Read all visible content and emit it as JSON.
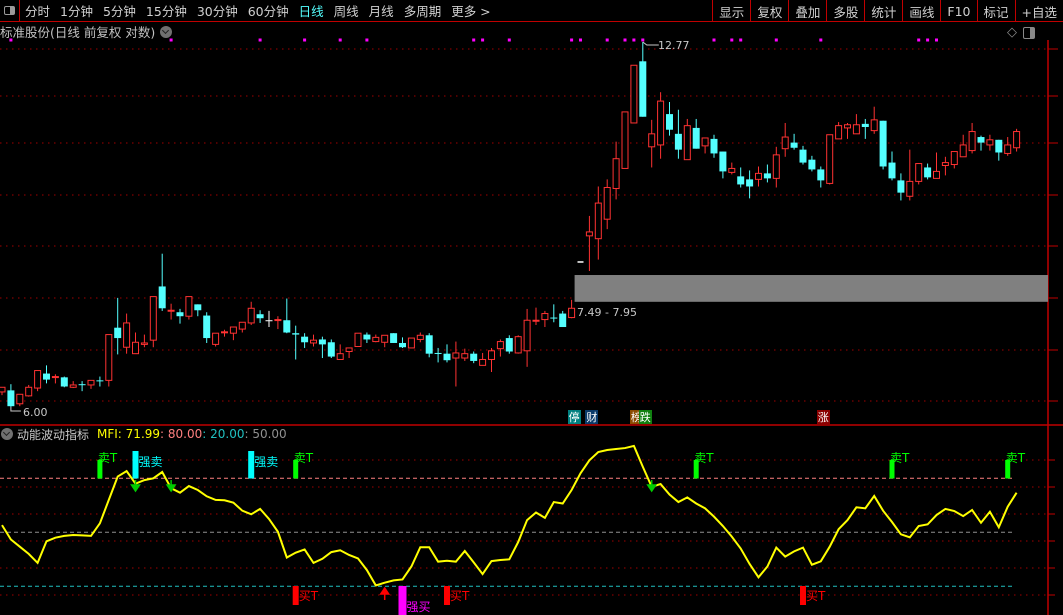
{
  "menubar": {
    "periods": [
      "分时",
      "1分钟",
      "5分钟",
      "15分钟",
      "30分钟",
      "60分钟",
      "日线",
      "周线",
      "月线",
      "多周期",
      "更多 >"
    ],
    "active_period": "日线",
    "buttons": [
      "显示",
      "复权",
      "叠加",
      "多股",
      "统计",
      "画线",
      "F10",
      "标记",
      "+自选"
    ]
  },
  "status": {
    "title": "标准股份(日线 前复权 对数)"
  },
  "annotations": {
    "high": "12.77",
    "low": "6.00",
    "gap": "7.49 - 7.95"
  },
  "badges": [
    {
      "label": "停",
      "index": 64,
      "color": "#008080"
    },
    {
      "label": "财",
      "index": 66,
      "color": "#0a3a6a"
    },
    {
      "label": "榜",
      "index": 71,
      "color": "#8a4a00"
    },
    {
      "label": "跌",
      "index": 72,
      "color": "#108010"
    },
    {
      "label": "涨",
      "index": 92,
      "color": "#8a0000"
    }
  ],
  "indicator": {
    "name": "动能波动指标",
    "mfi_label": "MFI: 71.99",
    "l80_label": ": 80.00",
    "l20_label": ": 20.00",
    "l50_label": ": 50.00",
    "sell_t": "卖T",
    "strong_sell": "强卖",
    "buy_t": "买T",
    "strong_buy": "强买"
  },
  "colors": {
    "up": "#ff3232",
    "down": "#54ffff",
    "doji": "#ffffff",
    "mfi": "#ffff00",
    "grid": "#a00000"
  },
  "chart_data": {
    "type": "candlestick",
    "scale": "log",
    "price_range": [
      6.0,
      12.77
    ],
    "gap": [
      7.49,
      7.95
    ],
    "ohlc_format": [
      "open",
      "high",
      "low",
      "close"
    ],
    "candles": [
      [
        6.19,
        6.25,
        6.15,
        6.25
      ],
      [
        6.21,
        6.29,
        6.0,
        6.01
      ],
      [
        6.04,
        6.16,
        6.01,
        6.16
      ],
      [
        6.14,
        6.28,
        6.13,
        6.25
      ],
      [
        6.24,
        6.47,
        6.2,
        6.47
      ],
      [
        6.43,
        6.54,
        6.3,
        6.35
      ],
      [
        6.38,
        6.42,
        6.3,
        6.39
      ],
      [
        6.38,
        6.39,
        6.25,
        6.26
      ],
      [
        6.25,
        6.33,
        6.24,
        6.28
      ],
      [
        6.29,
        6.33,
        6.2,
        6.28
      ],
      [
        6.28,
        6.34,
        6.23,
        6.34
      ],
      [
        6.34,
        6.39,
        6.26,
        6.33
      ],
      [
        6.34,
        6.97,
        6.26,
        6.97
      ],
      [
        7.07,
        7.52,
        6.69,
        6.92
      ],
      [
        6.79,
        7.28,
        6.7,
        7.14
      ],
      [
        6.7,
        7.0,
        6.7,
        6.86
      ],
      [
        6.83,
        6.97,
        6.79,
        6.85
      ],
      [
        6.89,
        7.54,
        6.79,
        7.54
      ],
      [
        7.7,
        8.24,
        7.32,
        7.36
      ],
      [
        7.32,
        7.43,
        7.19,
        7.33
      ],
      [
        7.3,
        7.35,
        7.13,
        7.24
      ],
      [
        7.24,
        7.54,
        7.19,
        7.54
      ],
      [
        7.42,
        7.42,
        7.24,
        7.33
      ],
      [
        7.25,
        7.3,
        6.85,
        6.92
      ],
      [
        6.83,
        6.99,
        6.8,
        6.99
      ],
      [
        7.0,
        7.04,
        6.94,
        7.01
      ],
      [
        6.99,
        7.08,
        6.89,
        7.08
      ],
      [
        7.05,
        7.15,
        7.0,
        7.15
      ],
      [
        7.14,
        7.46,
        7.11,
        7.36
      ],
      [
        7.27,
        7.33,
        7.14,
        7.21
      ],
      [
        7.18,
        7.32,
        7.08,
        7.18
      ],
      [
        7.18,
        7.24,
        7.05,
        7.19
      ],
      [
        7.18,
        7.51,
        6.99,
        7.0
      ],
      [
        6.99,
        7.1,
        6.62,
        6.97
      ],
      [
        6.94,
        6.99,
        6.78,
        6.86
      ],
      [
        6.85,
        6.97,
        6.8,
        6.89
      ],
      [
        6.9,
        6.94,
        6.64,
        6.83
      ],
      [
        6.86,
        6.9,
        6.64,
        6.66
      ],
      [
        6.62,
        6.83,
        6.62,
        6.7
      ],
      [
        6.73,
        6.78,
        6.64,
        6.78
      ],
      [
        6.8,
        6.99,
        6.8,
        6.99
      ],
      [
        6.97,
        7.0,
        6.85,
        6.9
      ],
      [
        6.87,
        6.97,
        6.86,
        6.93
      ],
      [
        6.86,
        6.96,
        6.79,
        6.96
      ],
      [
        6.99,
        6.99,
        6.85,
        6.85
      ],
      [
        6.85,
        6.93,
        6.78,
        6.79
      ],
      [
        6.78,
        6.92,
        6.78,
        6.92
      ],
      [
        6.9,
        7.0,
        6.86,
        6.96
      ],
      [
        6.96,
        6.99,
        6.65,
        6.7
      ],
      [
        6.71,
        6.78,
        6.58,
        6.7
      ],
      [
        6.7,
        6.83,
        6.58,
        6.61
      ],
      [
        6.64,
        6.87,
        6.26,
        6.71
      ],
      [
        6.64,
        6.77,
        6.6,
        6.7
      ],
      [
        6.7,
        6.73,
        6.57,
        6.6
      ],
      [
        6.54,
        6.71,
        6.54,
        6.62
      ],
      [
        6.62,
        6.78,
        6.45,
        6.74
      ],
      [
        6.77,
        6.9,
        6.66,
        6.87
      ],
      [
        6.92,
        6.96,
        6.7,
        6.73
      ],
      [
        6.71,
        6.96,
        6.7,
        6.94
      ],
      [
        6.74,
        7.35,
        6.52,
        7.18
      ],
      [
        7.17,
        7.37,
        7.11,
        7.18
      ],
      [
        7.19,
        7.32,
        7.08,
        7.28
      ],
      [
        7.22,
        7.42,
        7.15,
        7.21
      ],
      [
        7.28,
        7.32,
        7.08,
        7.08
      ],
      [
        7.22,
        7.49,
        7.21,
        7.36
      ],
      [
        8.1,
        8.1,
        8.1,
        8.1
      ],
      [
        8.55,
        8.91,
        7.95,
        8.62
      ],
      [
        8.5,
        9.47,
        8.14,
        9.15
      ],
      [
        8.85,
        9.61,
        8.67,
        9.45
      ],
      [
        9.43,
        10.39,
        9.22,
        10.03
      ],
      [
        9.83,
        11.05,
        9.83,
        11.05
      ],
      [
        10.8,
        12.17,
        10.8,
        12.17
      ],
      [
        12.27,
        12.77,
        10.94,
        10.94
      ],
      [
        10.28,
        10.87,
        9.85,
        10.56
      ],
      [
        10.32,
        11.51,
        10.03,
        11.3
      ],
      [
        11.0,
        11.28,
        10.52,
        10.65
      ],
      [
        10.56,
        11.1,
        10.03,
        10.22
      ],
      [
        10.01,
        10.89,
        10.01,
        10.74
      ],
      [
        10.69,
        10.89,
        10.24,
        10.24
      ],
      [
        10.3,
        10.47,
        10.14,
        10.47
      ],
      [
        10.45,
        10.54,
        10.05,
        10.14
      ],
      [
        10.18,
        10.18,
        9.63,
        9.77
      ],
      [
        9.75,
        9.95,
        9.71,
        9.83
      ],
      [
        9.67,
        9.85,
        9.45,
        9.51
      ],
      [
        9.61,
        9.79,
        9.24,
        9.47
      ],
      [
        9.61,
        9.87,
        9.47,
        9.73
      ],
      [
        9.73,
        9.91,
        9.55,
        9.63
      ],
      [
        9.63,
        10.28,
        9.45,
        10.11
      ],
      [
        10.24,
        10.8,
        10.07,
        10.49
      ],
      [
        10.37,
        10.56,
        10.22,
        10.26
      ],
      [
        10.22,
        10.3,
        9.91,
        9.95
      ],
      [
        10.01,
        10.09,
        9.77,
        9.81
      ],
      [
        9.81,
        9.87,
        9.45,
        9.59
      ],
      [
        9.53,
        10.54,
        9.51,
        10.54
      ],
      [
        10.45,
        10.82,
        10.45,
        10.74
      ],
      [
        10.69,
        10.8,
        10.45,
        10.76
      ],
      [
        10.56,
        11.0,
        10.56,
        10.76
      ],
      [
        10.78,
        10.89,
        10.45,
        10.71
      ],
      [
        10.63,
        11.17,
        10.56,
        10.87
      ],
      [
        10.85,
        10.85,
        9.81,
        9.87
      ],
      [
        9.95,
        10.18,
        9.59,
        9.63
      ],
      [
        9.59,
        9.73,
        9.2,
        9.35
      ],
      [
        9.28,
        10.22,
        9.2,
        9.57
      ],
      [
        9.57,
        9.93,
        9.51,
        9.93
      ],
      [
        9.85,
        9.93,
        9.61,
        9.65
      ],
      [
        9.63,
        10.16,
        9.63,
        9.77
      ],
      [
        9.89,
        10.07,
        9.69,
        9.95
      ],
      [
        9.91,
        10.18,
        9.83,
        10.18
      ],
      [
        10.07,
        10.54,
        10.07,
        10.32
      ],
      [
        10.2,
        10.8,
        10.14,
        10.61
      ],
      [
        10.49,
        10.52,
        10.2,
        10.37
      ],
      [
        10.32,
        10.54,
        10.2,
        10.43
      ],
      [
        10.43,
        10.43,
        9.99,
        10.16
      ],
      [
        10.14,
        10.49,
        10.09,
        10.32
      ],
      [
        10.26,
        10.67,
        10.18,
        10.61
      ]
    ],
    "top_markers": [
      1,
      19,
      29,
      34,
      38,
      41,
      53,
      54,
      57,
      64,
      65,
      68,
      70,
      71,
      72,
      80,
      82,
      83,
      87,
      92,
      103,
      104,
      105
    ],
    "mfi": {
      "levels": [
        80,
        50,
        20
      ],
      "values": [
        54,
        46,
        42,
        38,
        33,
        45,
        47,
        48,
        48.5,
        48.3,
        48,
        55,
        68,
        81,
        84,
        77,
        79,
        80,
        83.5,
        74.5,
        72,
        75.7,
        73.5,
        70,
        68,
        67.8,
        66.5,
        62,
        60,
        63,
        57.4,
        50.3,
        36,
        38.7,
        40.5,
        33,
        35.3,
        39,
        40,
        37.4,
        35.5,
        29,
        20.5,
        22,
        23.3,
        23.8,
        31,
        41.7,
        41.7,
        33.7,
        34.2,
        33.7,
        39.6,
        33.3,
        26.8,
        34,
        34.6,
        35,
        44.6,
        56.8,
        61,
        58,
        66.8,
        66,
        73.5,
        82.8,
        90,
        94.6,
        95.7,
        96.3,
        96.8,
        98,
        86.4,
        75.3,
        76.8,
        71,
        66.8,
        69.4,
        66,
        63.3,
        58.7,
        53.5,
        47.6,
        41,
        32.4,
        25,
        31,
        41.5,
        36.5,
        39.4,
        41.5,
        32,
        33.9,
        42,
        51.7,
        56.8,
        63.9,
        63.3,
        70.2,
        62,
        55.7,
        48.9,
        47.2,
        53.5,
        54.4,
        59.6,
        63,
        61.8,
        59,
        62.4,
        55.3,
        61.4,
        52.8,
        64.2,
        71.99
      ],
      "signals": [
        {
          "index": 11,
          "type": "sell_t"
        },
        {
          "index": 15,
          "type": "strong_sell"
        },
        {
          "index": 15,
          "type": "down_arrow"
        },
        {
          "index": 19,
          "type": "down_arrow"
        },
        {
          "index": 28,
          "type": "strong_sell"
        },
        {
          "index": 33,
          "type": "sell_t"
        },
        {
          "index": 33,
          "type": "buy_t"
        },
        {
          "index": 43,
          "type": "up_arrow"
        },
        {
          "index": 45,
          "type": "strong_buy"
        },
        {
          "index": 50,
          "type": "buy_t"
        },
        {
          "index": 73,
          "type": "down_arrow"
        },
        {
          "index": 78,
          "type": "sell_t"
        },
        {
          "index": 90,
          "type": "buy_t"
        },
        {
          "index": 100,
          "type": "sell_t"
        },
        {
          "index": 113,
          "type": "sell_t"
        }
      ]
    }
  }
}
